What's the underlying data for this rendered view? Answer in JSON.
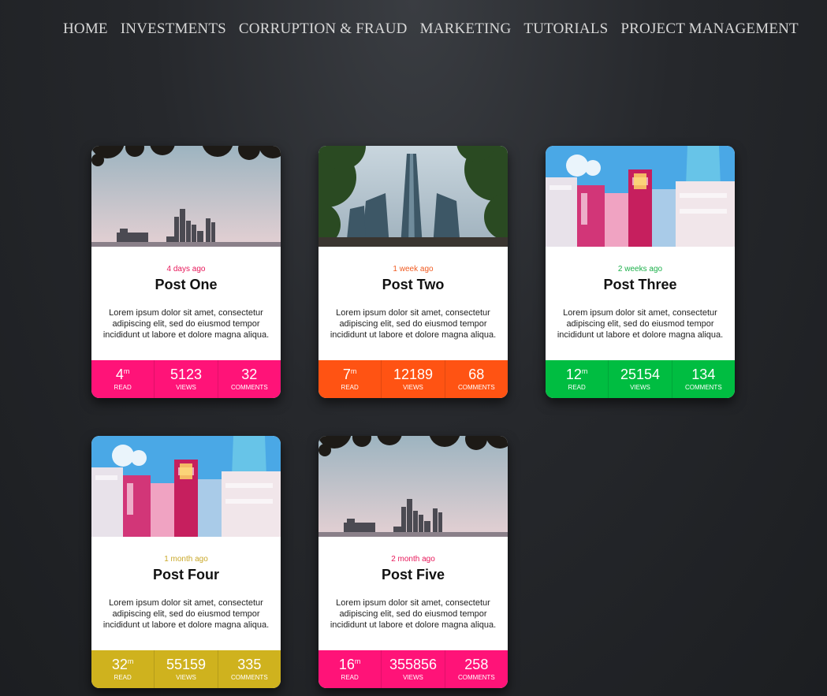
{
  "nav": {
    "items": [
      "HOME",
      "INVESTMENTS",
      "CORRUPTION & FRAUD",
      "MARKETING",
      "TUTORIALS",
      "PROJECT MANAGEMENT"
    ]
  },
  "posts": [
    {
      "date": "4 days ago",
      "title": "Post One",
      "excerpt": "Lorem ipsum dolor sit amet, consectetur adipiscing elit, sed do eiusmod tempor incididunt ut labore et dolore magna aliqua.",
      "read_value": "4",
      "read_unit": "m",
      "read_label": "READ",
      "views_value": "5123",
      "views_label": "VIEWS",
      "comments_value": "32",
      "comments_label": "COMMENTS",
      "accent_color": "#ff1378",
      "date_color": "#e7185a",
      "image_icon": "skyline-image"
    },
    {
      "date": "1 week ago",
      "title": "Post Two",
      "excerpt": "Lorem ipsum dolor sit amet, consectetur adipiscing elit, sed do eiusmod tempor incididunt ut labore et dolore magna aliqua.",
      "read_value": "7",
      "read_unit": "m",
      "read_label": "READ",
      "views_value": "12189",
      "views_label": "VIEWS",
      "comments_value": "68",
      "comments_label": "COMMENTS",
      "accent_color": "#ff5313",
      "date_color": "#f05a20",
      "image_icon": "tower-image"
    },
    {
      "date": "2 weeks ago",
      "title": "Post Three",
      "excerpt": "Lorem ipsum dolor sit amet, consectetur adipiscing elit, sed do eiusmod tempor incididunt ut labore et dolore magna aliqua.",
      "read_value": "12",
      "read_unit": "m",
      "read_label": "READ",
      "views_value": "25154",
      "views_label": "VIEWS",
      "comments_value": "134",
      "comments_label": "COMMENTS",
      "accent_color": "#00bd41",
      "date_color": "#1cb04a",
      "image_icon": "city-signs-image"
    },
    {
      "date": "1 month ago",
      "title": "Post Four",
      "excerpt": "Lorem ipsum dolor sit amet, consectetur adipiscing elit, sed do eiusmod tempor incididunt ut labore et dolore magna aliqua.",
      "read_value": "32",
      "read_unit": "m",
      "read_label": "READ",
      "views_value": "55159",
      "views_label": "VIEWS",
      "comments_value": "335",
      "comments_label": "COMMENTS",
      "accent_color": "#cfb21e",
      "date_color": "#c9a829",
      "image_icon": "city-signs-image"
    },
    {
      "date": "2 month ago",
      "title": "Post Five",
      "excerpt": "Lorem ipsum dolor sit amet, consectetur adipiscing elit, sed do eiusmod tempor incididunt ut labore et dolore magna aliqua.",
      "read_value": "16",
      "read_unit": "m",
      "read_label": "READ",
      "views_value": "355856",
      "views_label": "VIEWS",
      "comments_value": "258",
      "comments_label": "COMMENTS",
      "accent_color": "#ff1378",
      "date_color": "#e7185a",
      "image_icon": "skyline-image"
    }
  ]
}
